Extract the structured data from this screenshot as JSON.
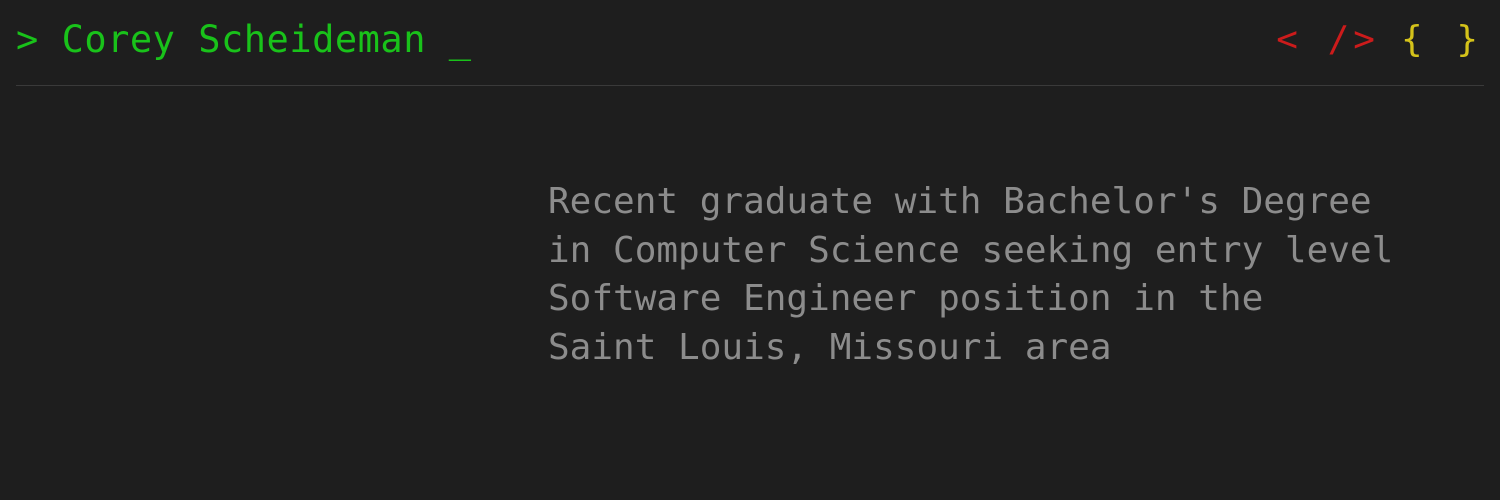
{
  "header": {
    "prompt": "> ",
    "name": "Corey Scheideman",
    "cursor": " _",
    "icons": {
      "code": {
        "name": "code-icon",
        "text": "< />",
        "color": "#cc1b1b"
      },
      "braces": {
        "name": "braces-icon",
        "text": "{ }",
        "color": "#d4c21a"
      }
    }
  },
  "main": {
    "summary": "Recent graduate with Bachelor's Degree\nin Computer Science seeking entry level\nSoftware Engineer position in the\nSaint Louis, Missouri area"
  },
  "colors": {
    "background": "#1e1e1e",
    "accent_green": "#19c21a",
    "text_gray": "#8c8c8c",
    "divider": "#3a3a3a"
  }
}
